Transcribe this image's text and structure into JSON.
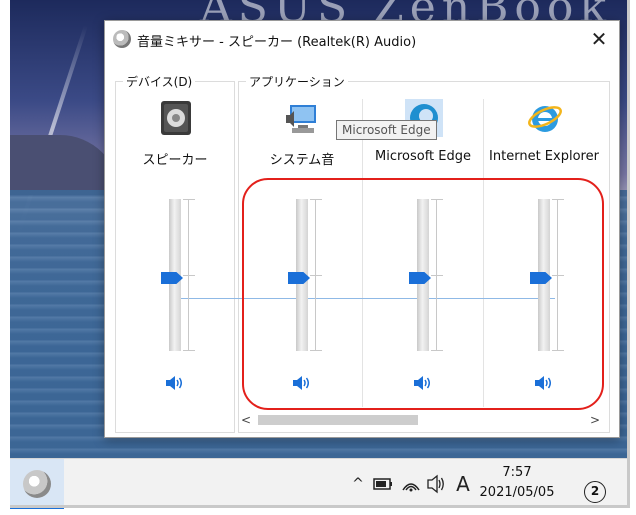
{
  "wallpaper": {
    "brand_text": "ASUS ZenBook"
  },
  "window": {
    "title": "音量ミキサー - スピーカー (Realtek(R) Audio)",
    "close_glyph": "✕"
  },
  "devices": {
    "group_label": "デバイス(D)",
    "items": [
      {
        "name": "スピーカー",
        "icon": "speaker-device-icon",
        "level": 0.48
      }
    ]
  },
  "applications": {
    "group_label": "アプリケーション",
    "items": [
      {
        "name": "システム音",
        "icon": "system-sounds-icon",
        "level": 0.48
      },
      {
        "name": "Microsoft Edge",
        "icon": "edge-icon",
        "level": 0.48
      },
      {
        "name": "Internet Explorer",
        "icon": "internet-explorer-icon",
        "level": 0.48
      }
    ]
  },
  "tooltip": {
    "text": "Microsoft Edge"
  },
  "scrollbar": {
    "left_arrow": "<",
    "right_arrow": ">"
  },
  "taskbar": {
    "tray": {
      "chevron": "^",
      "ime": "A"
    },
    "time": "7:57",
    "date": "2021/05/05",
    "notification_count": "2"
  },
  "colors": {
    "accent": "#1a6fd8",
    "highlight": "#e3201b"
  }
}
